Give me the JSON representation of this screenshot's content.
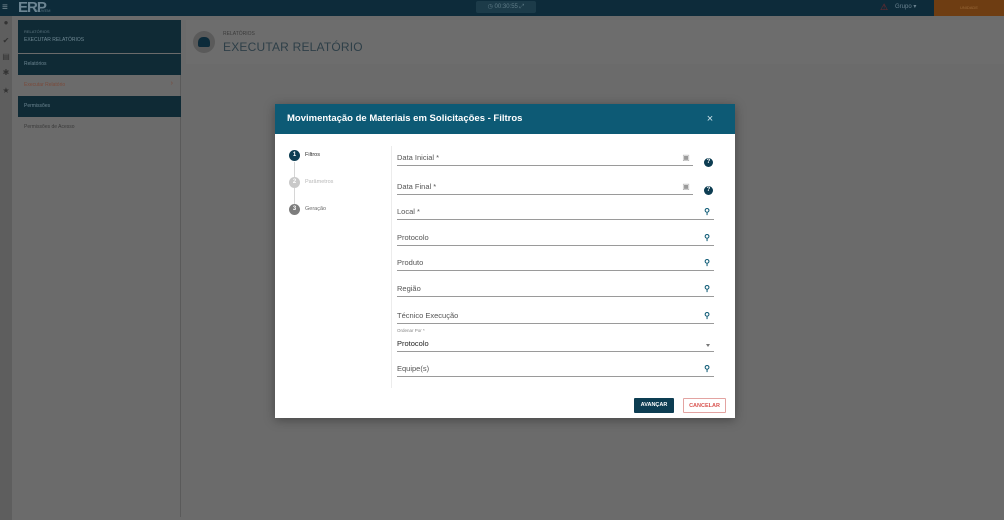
{
  "app": {
    "logo": "ERP",
    "logo_sub": "NUVEM",
    "clock": "00:30:55",
    "group": "Grupo",
    "user_area": "UNIDADE"
  },
  "sidebar": {
    "header_small": "RELATÓRIOS",
    "header_title": "EXECUTAR RELATÓRIOS",
    "section_reports": "Relatórios",
    "item_execute": "Executar Relatório",
    "section_permissions": "Permissões",
    "item_access": "Permissões de Acesso"
  },
  "page": {
    "breadcrumb": "RELATÓRIOS",
    "title": "EXECUTAR RELATÓRIO"
  },
  "modal": {
    "title": "Movimentação de Materiais em Solicitações - Filtros",
    "close_symbol": "×",
    "steps": [
      {
        "number": "1",
        "label": "Filtros"
      },
      {
        "number": "2",
        "label": "Parâmetros"
      },
      {
        "number": "3",
        "label": "Geração"
      }
    ],
    "fields": {
      "data_inicial": "Data Inicial *",
      "data_final": "Data Final *",
      "local": "Local *",
      "protocolo": "Protocolo",
      "produto": "Produto",
      "regiao": "Região",
      "tecnico": "Técnico Execução",
      "ordenar_label": "Ordenar Por *",
      "ordenar_value": "Protocolo",
      "equipes": "Equipe(s)"
    },
    "help_symbol": "?",
    "buttons": {
      "next": "AVANÇAR",
      "cancel": "CANCELAR"
    }
  }
}
